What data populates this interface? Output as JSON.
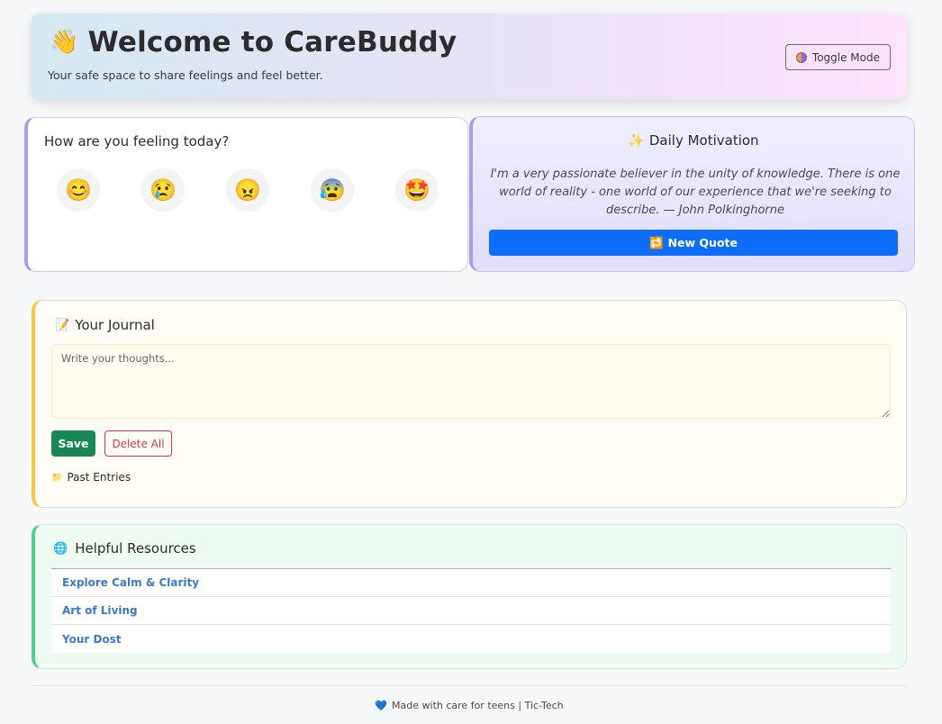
{
  "header": {
    "title": "Welcome to CareBuddy",
    "wave_icon": "👋",
    "subtitle": "Your safe space to share feelings and feel better.",
    "toggle_label": "Toggle Mode"
  },
  "mood": {
    "question": "How are you feeling today?",
    "emojis": [
      "😊",
      "😢",
      "😠",
      "😰",
      "🤩"
    ]
  },
  "motivation": {
    "icon": "✨",
    "heading": "Daily Motivation",
    "quote": "I'm a very passionate believer in the unity of knowledge. There is one world of reality - one world of our experience that we're seeking to describe. — John Polkinghorne",
    "button_icon": "🔁",
    "button_label": "New Quote"
  },
  "journal": {
    "icon": "📝",
    "heading": "Your Journal",
    "placeholder": "Write your thoughts...",
    "save_label": "Save",
    "delete_label": "Delete All",
    "past_icon": "📁",
    "past_label": "Past Entries"
  },
  "resources": {
    "icon": "🌐",
    "heading": "Helpful Resources",
    "items": [
      "Explore Calm & Clarity",
      "Art of Living",
      "Your Dost"
    ]
  },
  "footer": {
    "heart": "💙",
    "text": "Made with care for teens | Tic-Tech"
  }
}
